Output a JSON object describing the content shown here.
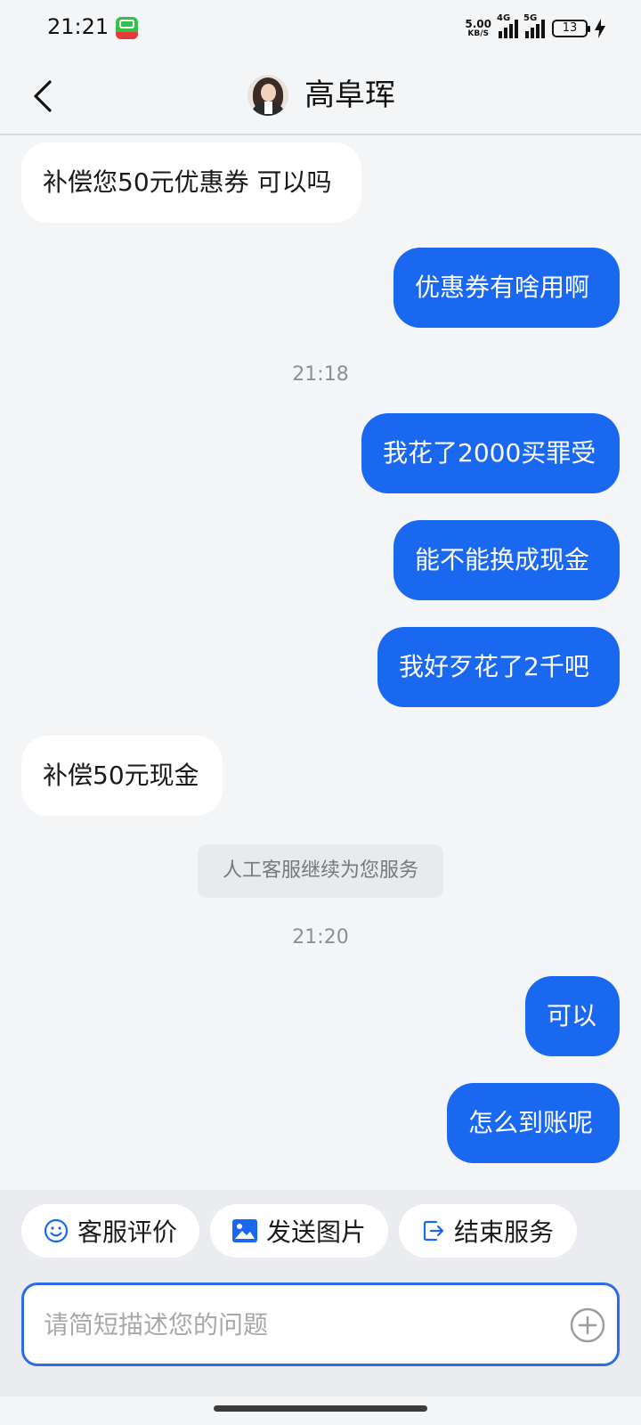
{
  "status_bar": {
    "time": "21:21",
    "net_speed_value": "5.00",
    "net_speed_unit": "KB/S",
    "signal_1_label": "4G",
    "signal_2_label": "5G",
    "battery": "13"
  },
  "header": {
    "title": "高阜珲"
  },
  "messages": [
    {
      "side": "in",
      "text": "补偿您50元优惠券 可以吗"
    },
    {
      "side": "out",
      "text": "优惠券有啥用啊"
    },
    {
      "type": "time",
      "text": "21:18"
    },
    {
      "side": "out",
      "text": "我花了2000买罪受"
    },
    {
      "side": "out",
      "text": "能不能换成现金"
    },
    {
      "side": "out",
      "text": "我好歹花了2千吧"
    },
    {
      "side": "in",
      "text": "补偿50元现金"
    },
    {
      "type": "notice",
      "text": "人工客服继续为您服务"
    },
    {
      "type": "time",
      "text": "21:20"
    },
    {
      "side": "out",
      "text": "可以"
    },
    {
      "side": "out",
      "text": "怎么到账呢"
    }
  ],
  "quick_actions": {
    "rate": "客服评价",
    "send_image": "发送图片",
    "end_service": "结束服务"
  },
  "input": {
    "placeholder": "请简短描述您的问题"
  },
  "colors": {
    "accent": "#1a68f0",
    "background": "#f4f5f7"
  }
}
